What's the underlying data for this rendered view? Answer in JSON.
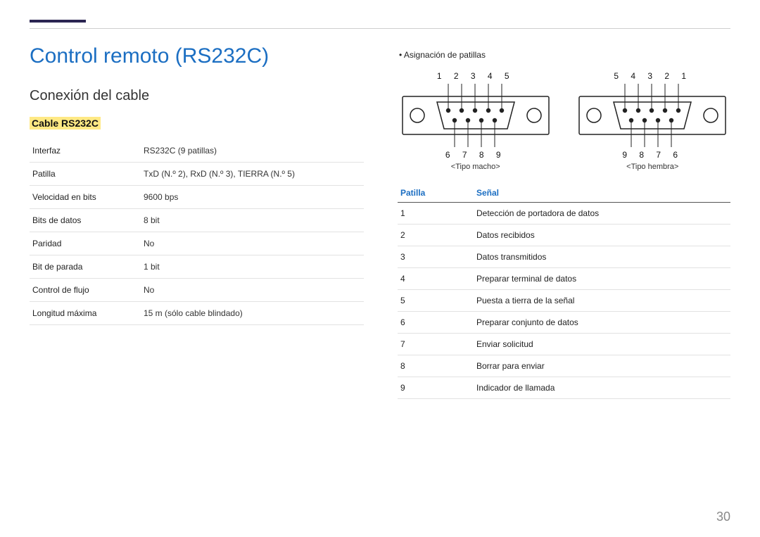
{
  "page_number": "30",
  "title": "Control remoto (RS232C)",
  "section": "Conexión del cable",
  "subsection": "Cable RS232C",
  "spec_rows": [
    {
      "k": "Interfaz",
      "v": "RS232C (9 patillas)"
    },
    {
      "k": "Patilla",
      "v": "TxD (N.º 2), RxD (N.º 3), TIERRA (N.º 5)"
    },
    {
      "k": "Velocidad en bits",
      "v": "9600 bps"
    },
    {
      "k": "Bits de datos",
      "v": "8 bit"
    },
    {
      "k": "Paridad",
      "v": "No"
    },
    {
      "k": "Bit de parada",
      "v": "1 bit"
    },
    {
      "k": "Control de flujo",
      "v": "No"
    },
    {
      "k": "Longitud máxima",
      "v": "15 m (sólo cable blindado)"
    }
  ],
  "right": {
    "bullet": "Asignación de patillas",
    "connectors": [
      {
        "top": "1  2  3  4  5",
        "bot": "6  7  8  9",
        "caption": "<Tipo macho>"
      },
      {
        "top": "5  4  3  2  1",
        "bot": "9  8  7  6",
        "caption": "<Tipo hembra>"
      }
    ],
    "signal_header": {
      "pin": "Patilla",
      "sig": "Señal"
    },
    "signal_rows": [
      {
        "p": "1",
        "s": "Detección de portadora de datos"
      },
      {
        "p": "2",
        "s": "Datos recibidos"
      },
      {
        "p": "3",
        "s": "Datos transmitidos"
      },
      {
        "p": "4",
        "s": "Preparar terminal de datos"
      },
      {
        "p": "5",
        "s": "Puesta a tierra de la señal"
      },
      {
        "p": "6",
        "s": "Preparar conjunto de datos"
      },
      {
        "p": "7",
        "s": "Enviar solicitud"
      },
      {
        "p": "8",
        "s": "Borrar para enviar"
      },
      {
        "p": "9",
        "s": "Indicador de llamada"
      }
    ]
  }
}
